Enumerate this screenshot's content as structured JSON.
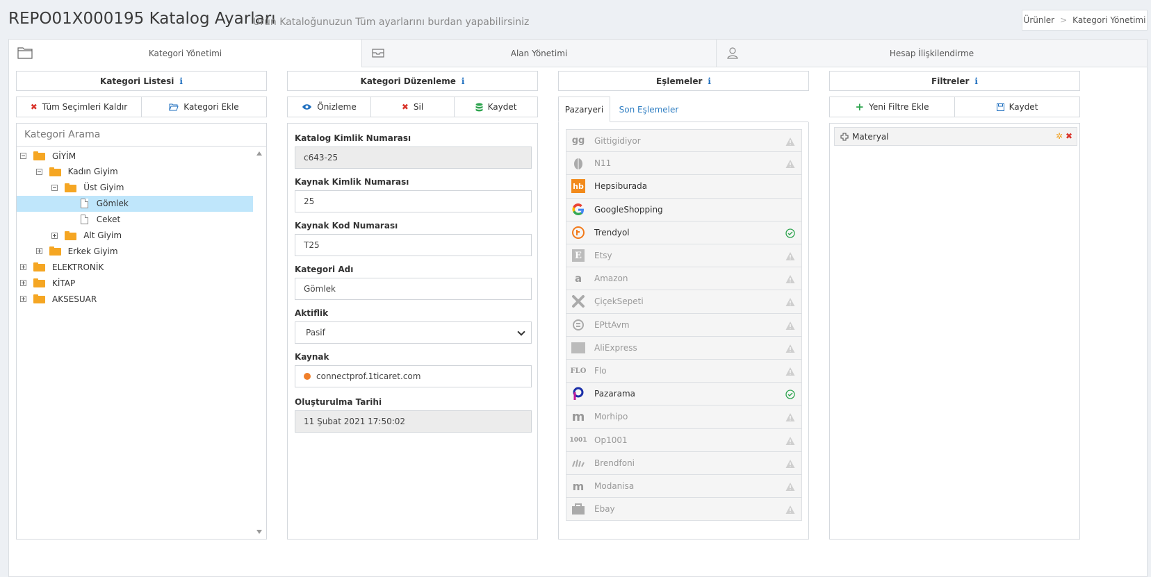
{
  "header": {
    "title": "REPO01X000195 Katalog Ayarları",
    "subtitle": "Ürün Kataloğunuzun Tüm ayarlarını burdan yapabilirsiniz",
    "breadcrumb": [
      "Ürünler",
      "Kategori Yönetimi"
    ],
    "breadcrumb_sep": ">"
  },
  "tabs": [
    {
      "label": "Kategori Yönetimi",
      "icon": "folder-outline-icon",
      "active": true
    },
    {
      "label": "Alan Yönetimi",
      "icon": "inbox-icon",
      "active": false
    },
    {
      "label": "Hesap İlişkilendirme",
      "icon": "user-icon",
      "active": false
    }
  ],
  "category_list": {
    "title": "Kategori Listesi",
    "clear_label": "Tüm Seçimleri Kaldır",
    "add_label": "Kategori Ekle",
    "search_placeholder": "Kategori Arama",
    "tree": [
      {
        "label": "GİYİM",
        "type": "folder",
        "expanded": true
      },
      {
        "label": "Kadın Giyim",
        "type": "folder",
        "expanded": true
      },
      {
        "label": "Üst Giyim",
        "type": "folder",
        "expanded": true
      },
      {
        "label": "Gömlek",
        "type": "file",
        "selected": true
      },
      {
        "label": "Ceket",
        "type": "file"
      },
      {
        "label": "Alt Giyim",
        "type": "folder",
        "expanded": false
      },
      {
        "label": "Erkek Giyim",
        "type": "folder",
        "expanded": false
      },
      {
        "label": "ELEKTRONİK",
        "type": "folder",
        "expanded": false
      },
      {
        "label": "KİTAP",
        "type": "folder",
        "expanded": false
      },
      {
        "label": "AKSESUAR",
        "type": "folder",
        "expanded": false
      }
    ]
  },
  "category_edit": {
    "title": "Kategori Düzenleme",
    "preview_label": "Önizleme",
    "delete_label": "Sil",
    "save_label": "Kaydet",
    "fields": {
      "catalog_id_label": "Katalog Kimlik Numarası",
      "catalog_id_value": "c643-25",
      "source_id_label": "Kaynak Kimlik Numarası",
      "source_id_value": "25",
      "source_code_label": "Kaynak Kod Numarası",
      "source_code_value": "T25",
      "category_name_label": "Kategori Adı",
      "category_name_value": "Gömlek",
      "active_label": "Aktiflik",
      "active_value": "Pasif",
      "source_label": "Kaynak",
      "source_value": "connectprof.1ticaret.com",
      "created_label": "Oluşturulma Tarihi",
      "created_value": "11 Şubat 2021 17:50:02"
    }
  },
  "mappings": {
    "title": "Eşlemeler",
    "tab_marketplaces": "Pazaryeri",
    "tab_recent": "Son Eşlemeler",
    "items": [
      {
        "name": "Gittigidiyor",
        "active": false,
        "status": "warning"
      },
      {
        "name": "N11",
        "active": false,
        "status": "warning"
      },
      {
        "name": "Hepsiburada",
        "active": true,
        "status": "none"
      },
      {
        "name": "GoogleShopping",
        "active": true,
        "status": "none"
      },
      {
        "name": "Trendyol",
        "active": true,
        "status": "ok"
      },
      {
        "name": "Etsy",
        "active": false,
        "status": "warning"
      },
      {
        "name": "Amazon",
        "active": false,
        "status": "warning"
      },
      {
        "name": "ÇiçekSepeti",
        "active": false,
        "status": "warning"
      },
      {
        "name": "EPttAvm",
        "active": false,
        "status": "warning"
      },
      {
        "name": "AliExpress",
        "active": false,
        "status": "warning"
      },
      {
        "name": "Flo",
        "active": false,
        "status": "warning"
      },
      {
        "name": "Pazarama",
        "active": true,
        "status": "ok"
      },
      {
        "name": "Morhipo",
        "active": false,
        "status": "warning"
      },
      {
        "name": "Op1001",
        "active": false,
        "status": "warning"
      },
      {
        "name": "Brendfoni",
        "active": false,
        "status": "warning"
      },
      {
        "name": "Modanisa",
        "active": false,
        "status": "warning"
      },
      {
        "name": "Ebay",
        "active": false,
        "status": "warning"
      }
    ],
    "logo_text": {
      "Gittigidiyor": "gg",
      "Hepsiburada": "hb",
      "Etsy": "E",
      "Amazon": "a",
      "Flo": "FLO",
      "Morhipo": "m",
      "Op1001": "1001",
      "Modanisa": "m"
    }
  },
  "filters": {
    "title": "Filtreler",
    "add_label": "Yeni Filtre Ekle",
    "save_label": "Kaydet",
    "items": [
      {
        "label": "Materyal"
      }
    ]
  },
  "colors": {
    "accent": "#1f6fbf",
    "folder": "#f5a623",
    "selected_row": "#bfe6fb",
    "ok": "#2ea44f",
    "warning": "#c8c8c8",
    "delete": "#d9342b",
    "add": "#2ea44f"
  }
}
